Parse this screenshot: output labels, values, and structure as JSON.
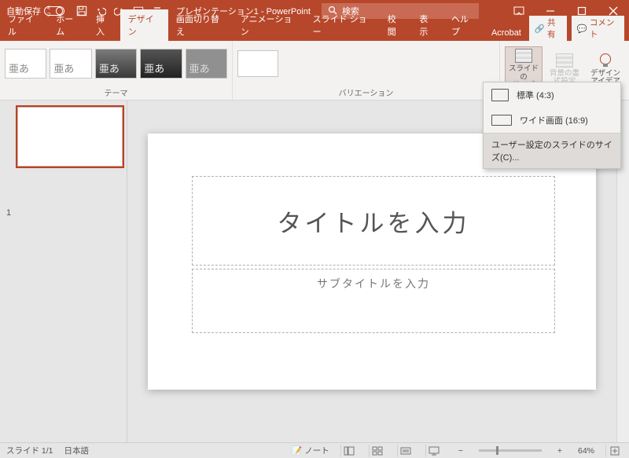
{
  "titlebar": {
    "autosave_label": "自動保存",
    "autosave_state": "オフ",
    "doc_title": "プレゼンテーション1 - PowerPoint",
    "search_placeholder": "検索"
  },
  "tabs": {
    "file": "ファイル",
    "home": "ホーム",
    "insert": "挿入",
    "design": "デザイン",
    "transitions": "画面切り替え",
    "animations": "アニメーション",
    "slideshow": "スライド ショー",
    "review": "校閲",
    "view": "表示",
    "help": "ヘルプ",
    "acrobat": "Acrobat",
    "share": "共有",
    "comments": "コメント"
  },
  "ribbon": {
    "theme_label": "テーマ",
    "variation_label": "バリエーション",
    "theme_sample": "亜あ",
    "slide_size": "スライドの\nサイズ",
    "bg_format": "背景の書\n式設定",
    "design_ideas": "デザイン\nアイデア"
  },
  "dropdown": {
    "standard": "標準 (4:3)",
    "wide": "ワイド画面 (16:9)",
    "custom": "ユーザー設定のスライドのサイズ(C)..."
  },
  "thumbs": {
    "num1": "1"
  },
  "slide": {
    "title_placeholder": "タイトルを入力",
    "subtitle_placeholder": "サブタイトルを入力"
  },
  "status": {
    "slide_count": "スライド 1/1",
    "lang": "日本語",
    "notes": "ノート",
    "zoom_minus": "−",
    "zoom_plus": "+",
    "zoom_pct": "64%"
  }
}
